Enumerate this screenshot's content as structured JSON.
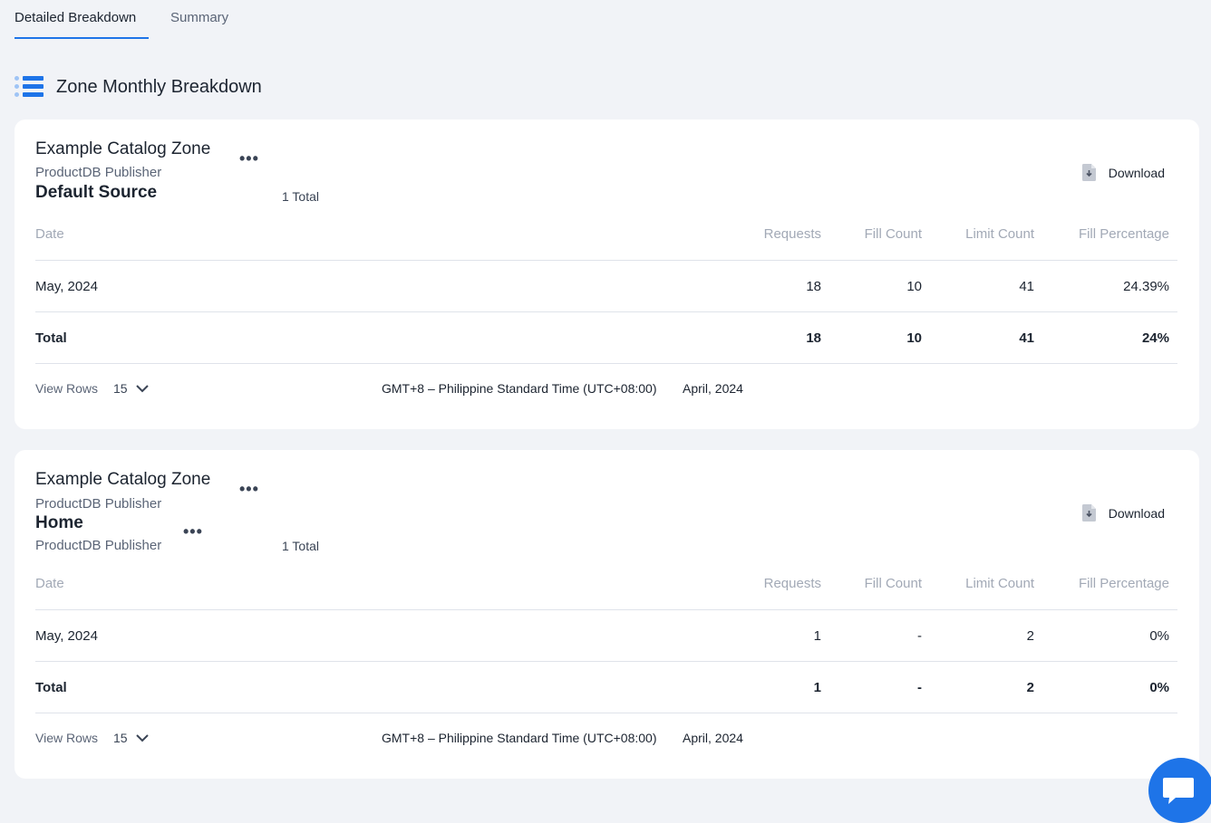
{
  "tabs": [
    {
      "label": "Detailed Breakdown",
      "active": true
    },
    {
      "label": "Summary",
      "active": false
    }
  ],
  "section": {
    "title": "Zone Monthly Breakdown",
    "icon": "list-icon"
  },
  "colors": {
    "accent": "#1e74e8",
    "background": "#f1f3f7"
  },
  "columns": [
    "Date",
    "Requests",
    "Fill Count",
    "Limit Count",
    "Fill Percentage"
  ],
  "cards": [
    {
      "zone_name": "Example Catalog Zone",
      "zone_publisher": "ProductDB Publisher",
      "source_name": "Default Source",
      "total_count": "1 Total",
      "download_label": "Download",
      "rows": [
        {
          "date": "May, 2024",
          "requests": "18",
          "fill_count": "10",
          "limit_count": "41",
          "fill_percentage": "24.39%"
        }
      ],
      "total": {
        "label": "Total",
        "requests": "18",
        "fill_count": "10",
        "limit_count": "41",
        "fill_percentage": "24%"
      },
      "footer": {
        "view_rows_label": "View Rows",
        "view_rows_value": "15",
        "timezone": "GMT+8 – Philippine Standard Time (UTC+08:00)",
        "month": "April, 2024"
      }
    },
    {
      "zone_name": "Example Catalog Zone",
      "zone_publisher": "ProductDB Publisher",
      "source_name": "Home",
      "source_publisher": "ProductDB Publisher",
      "total_count": "1 Total",
      "download_label": "Download",
      "rows": [
        {
          "date": "May, 2024",
          "requests": "1",
          "fill_count": "-",
          "limit_count": "2",
          "fill_percentage": "0%"
        }
      ],
      "total": {
        "label": "Total",
        "requests": "1",
        "fill_count": "-",
        "limit_count": "2",
        "fill_percentage": "0%"
      },
      "footer": {
        "view_rows_label": "View Rows",
        "view_rows_value": "15",
        "timezone": "GMT+8 – Philippine Standard Time (UTC+08:00)",
        "month": "April, 2024"
      }
    }
  ],
  "more_icon": "ellipsis-icon",
  "chat_icon": "chat-bubble-icon"
}
